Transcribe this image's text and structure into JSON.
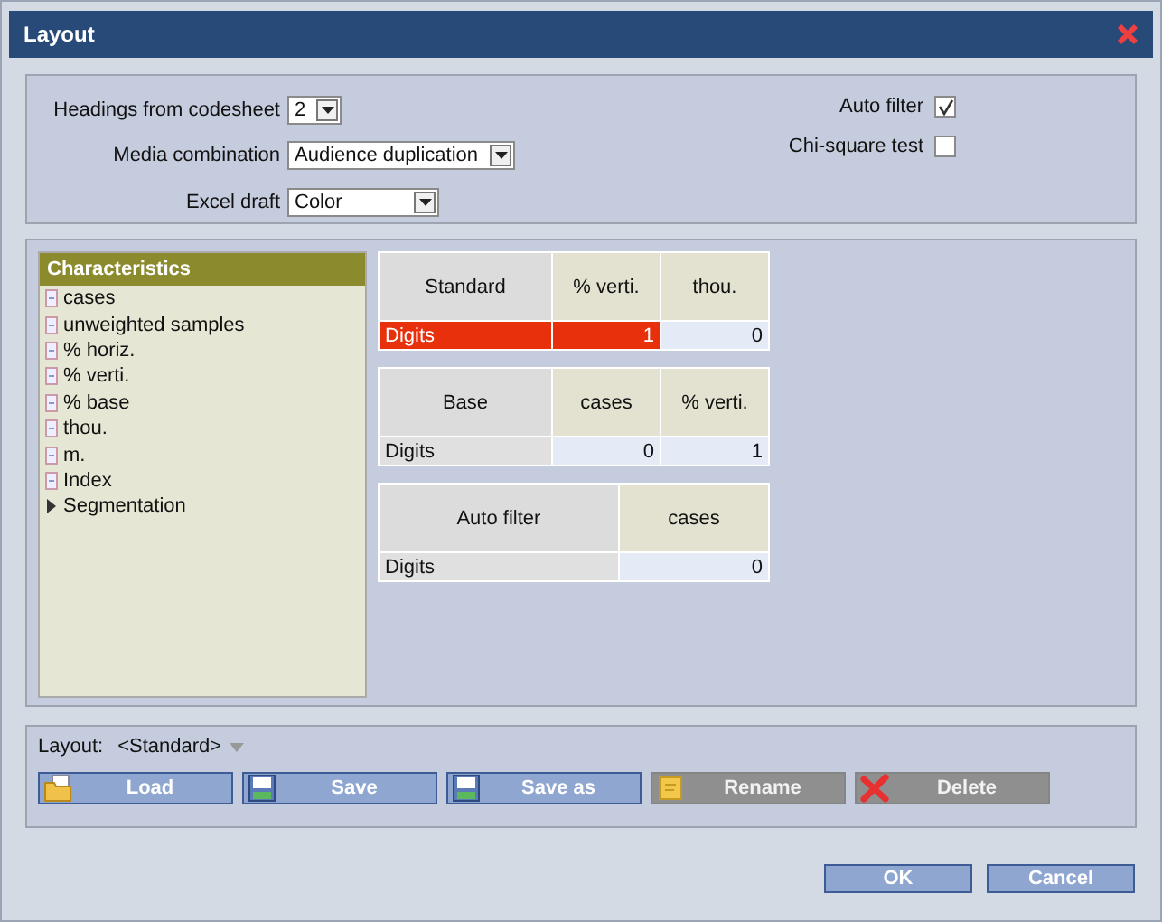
{
  "window": {
    "title": "Layout"
  },
  "options": {
    "left": [
      {
        "label": "Headings from codesheet",
        "value": "2"
      },
      {
        "label": "Media combination",
        "value": "Audience duplication"
      },
      {
        "label": "Excel draft",
        "value": "Color"
      }
    ],
    "right": [
      {
        "label": "Auto filter",
        "checked": true
      },
      {
        "label": "Chi-square test",
        "checked": false
      }
    ]
  },
  "characteristics": {
    "title": "Characteristics",
    "items": [
      {
        "kind": "leaf",
        "label": "cases"
      },
      {
        "kind": "leaf",
        "label": "unweighted samples"
      },
      {
        "kind": "leaf",
        "label": "% horiz."
      },
      {
        "kind": "leaf",
        "label": "% verti."
      },
      {
        "kind": "leaf",
        "label": "% base"
      },
      {
        "kind": "leaf",
        "label": "thou."
      },
      {
        "kind": "leaf",
        "label": "m."
      },
      {
        "kind": "leaf",
        "label": "Index"
      },
      {
        "kind": "group",
        "label": "Segmentation",
        "expanded": false
      }
    ]
  },
  "tables": [
    {
      "columns": [
        "Standard",
        "% verti.",
        "thou."
      ],
      "rows": [
        {
          "cells": [
            {
              "text": "Digits",
              "selected": true
            },
            {
              "text": "1",
              "selected": true
            },
            {
              "text": "0",
              "selected": false
            }
          ]
        }
      ]
    },
    {
      "columns": [
        "Base",
        "cases",
        "% verti."
      ],
      "rows": [
        {
          "cells": [
            {
              "text": "Digits",
              "selected": false
            },
            {
              "text": "0",
              "selected": false
            },
            {
              "text": "1",
              "selected": false
            }
          ]
        }
      ]
    },
    {
      "columns": [
        "Auto filter",
        "cases"
      ],
      "rows": [
        {
          "cells": [
            {
              "text": "Digits",
              "selected": false
            },
            {
              "text": "0",
              "selected": false
            }
          ]
        }
      ]
    }
  ],
  "layout_selector": {
    "label": "Layout:",
    "value": "<Standard>"
  },
  "layout_buttons": [
    {
      "label": "Load",
      "disabled": false
    },
    {
      "label": "Save",
      "disabled": false
    },
    {
      "label": "Save as",
      "disabled": false
    },
    {
      "label": "Rename",
      "disabled": true
    },
    {
      "label": "Delete",
      "disabled": true
    }
  ],
  "buttons": [
    "OK",
    "Cancel"
  ]
}
